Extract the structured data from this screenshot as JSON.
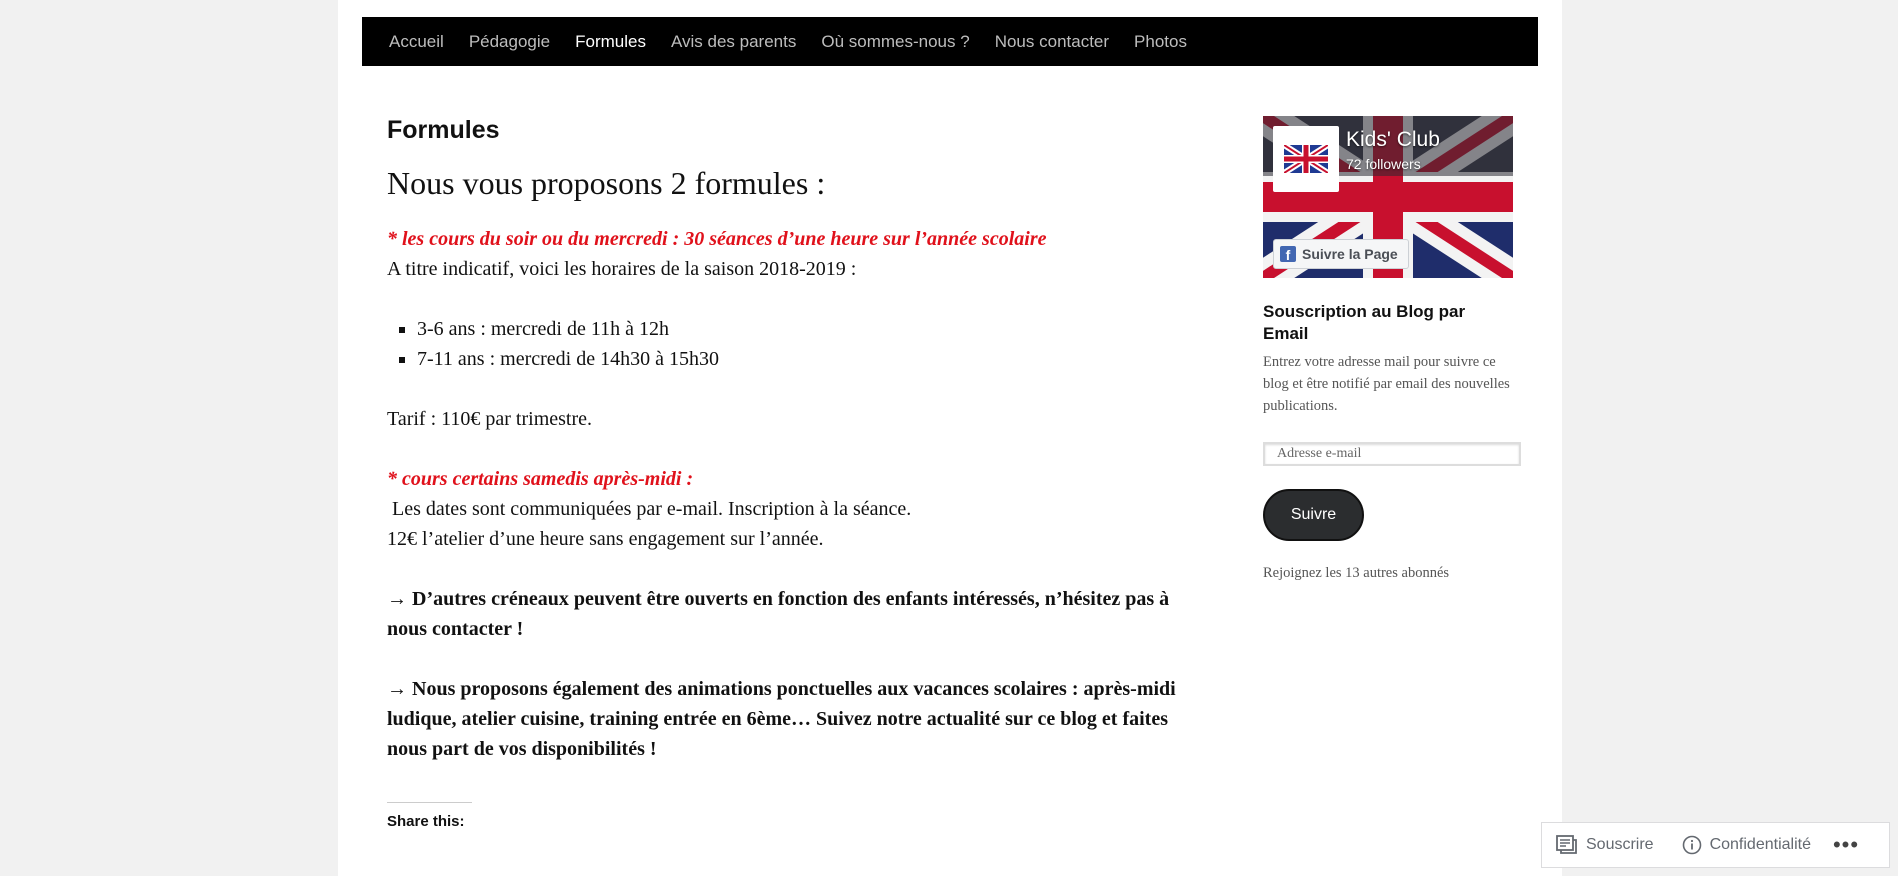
{
  "nav": {
    "items": [
      {
        "label": "Accueil"
      },
      {
        "label": "Pédagogie"
      },
      {
        "label": "Formules"
      },
      {
        "label": "Avis des parents"
      },
      {
        "label": "Où sommes-nous ?"
      },
      {
        "label": "Nous contacter"
      },
      {
        "label": "Photos"
      }
    ],
    "current": "Formules"
  },
  "article": {
    "title": "Formules",
    "lead": "Nous vous proposons 2 formules :",
    "offer1_heading": "* les cours du soir ou du mercredi : 30 séances d’une heure sur l’année scolaire",
    "offer1_intro": "A titre indicatif, voici les horaires de la saison 2018-2019 :",
    "schedule": [
      "3-6 ans : mercredi de 11h à 12h",
      "7-11 ans : mercredi de 14h30 à 15h30"
    ],
    "tarif": "Tarif : 110€ par trimestre.",
    "offer2_heading": "* cours certains samedis après-midi :",
    "offer2_line1": " Les dates sont communiquées par e-mail. Inscription à la séance.",
    "offer2_line2": "12€ l’atelier d’une heure sans engagement sur l’année.",
    "note1": "→ D’autres créneaux peuvent être ouverts en fonction des enfants intéressés, n’hésitez pas à nous contacter !",
    "note2": "→ Nous proposons également des animations ponctuelles aux vacances scolaires : après-midi ludique, atelier cuisine, training entrée en 6ème… Suivez notre actualité sur ce blog et faites nous part de vos disponibilités !",
    "share_label": "Share this:"
  },
  "sidebar": {
    "fb": {
      "page_name": "Kids' Club",
      "followers": "72 followers",
      "follow_label": "Suivre la Page",
      "icon": "facebook-icon"
    },
    "subscribe": {
      "title": "Souscription au Blog par Email",
      "description": "Entrez votre adresse mail pour suivre ce blog et être notifié par email des nouvelles publications.",
      "email_placeholder": "Adresse e-mail",
      "button_label": "Suivre",
      "join_text": "Rejoignez les 13 autres abonnés"
    }
  },
  "actionbar": {
    "subscribe_label": "Souscrire",
    "privacy_label": "Confidentialité",
    "more_label": "•••"
  },
  "colors": {
    "accent_red": "#e0111b",
    "nav_bg": "#000000",
    "button_bg": "#2b2d2f"
  }
}
